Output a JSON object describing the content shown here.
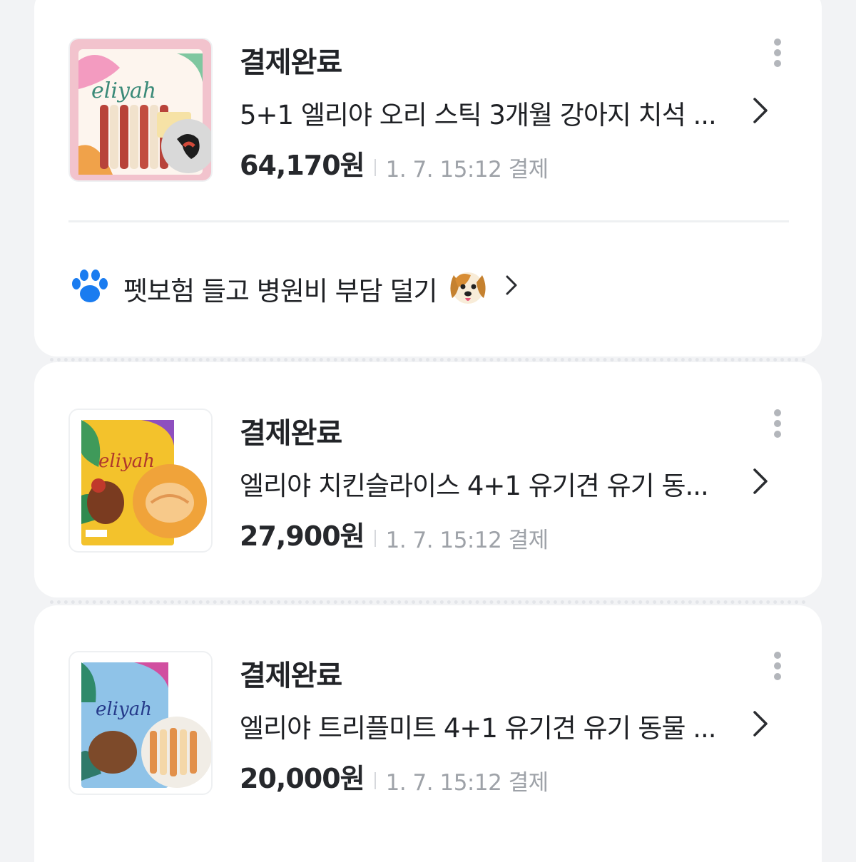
{
  "orders": [
    {
      "status": "결제완료",
      "product_name": "5+1 엘리야 오리 스틱 3개월 강아지 치석 ...",
      "price": "64,170원",
      "meta": "1. 7. 15:12 결제",
      "thumb_brand": "eliyah",
      "thumb_bg": "#f2c3cd"
    },
    {
      "status": "결제완료",
      "product_name": "엘리야 치킨슬라이스 4+1 유기견 유기 동...",
      "price": "27,900원",
      "meta": "1. 7. 15:12 결제",
      "thumb_brand": "eliyah",
      "thumb_bg": "#f3c22c"
    },
    {
      "status": "결제완료",
      "product_name": "엘리야 트리플미트 4+1 유기견 유기 동물 ...",
      "price": "20,000원",
      "meta": "1. 7. 15:12 결제",
      "thumb_brand": "eliyah",
      "thumb_bg": "#8fc3e8"
    }
  ],
  "promo": {
    "text": "펫보험 들고 병원비 부담 덜기",
    "icon": "paw-icon",
    "emoji": "dog-face-icon",
    "accent": "#1a7cf0"
  },
  "icons": {
    "more": "more-vertical-icon",
    "chevron": "chevron-right-icon"
  }
}
